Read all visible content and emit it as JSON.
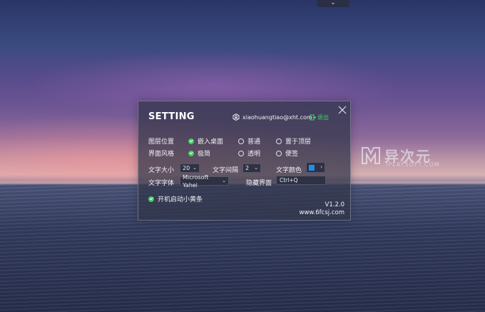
{
  "top_tab": {
    "icon": "chevron-down-icon",
    "glyph": "⌄"
  },
  "watermark": {
    "logo_icon": "iplaysoft-logo-icon",
    "cn": "异次元",
    "en": "IPLAYSOFT.COM"
  },
  "panel": {
    "title": "SETTING",
    "close_icon": "close-icon",
    "user": {
      "icon": "user-hex-icon",
      "email": "xiaohuangtiao@xht.com"
    },
    "logout": {
      "icon": "logout-icon",
      "label": "退出",
      "color": "#45d06a"
    },
    "layer_position": {
      "label": "图层位置",
      "options": [
        {
          "label": "嵌入桌面",
          "checked": true
        },
        {
          "label": "普通",
          "checked": false
        },
        {
          "label": "置于顶层",
          "checked": false
        }
      ]
    },
    "ui_style": {
      "label": "界面风格",
      "options": [
        {
          "label": "极简",
          "checked": true
        },
        {
          "label": "透明",
          "checked": false
        },
        {
          "label": "便签",
          "checked": false
        }
      ]
    },
    "font_size": {
      "label": "文字大小",
      "value": "20"
    },
    "line_spacing": {
      "label": "文字间隔",
      "value": "2"
    },
    "text_color": {
      "label": "文字颜色",
      "value": "#1e8fe8"
    },
    "font_family": {
      "label": "文字字体",
      "value": "Microsoft Yahei"
    },
    "hide_ui": {
      "label": "隐藏界面",
      "value": "Ctrl+Q"
    },
    "startup": {
      "label": "开机启动小黄条",
      "checked": true
    },
    "version": "V1.2.0",
    "website": "www.6fcsj.com",
    "accent_color": "#3fcf5d"
  }
}
